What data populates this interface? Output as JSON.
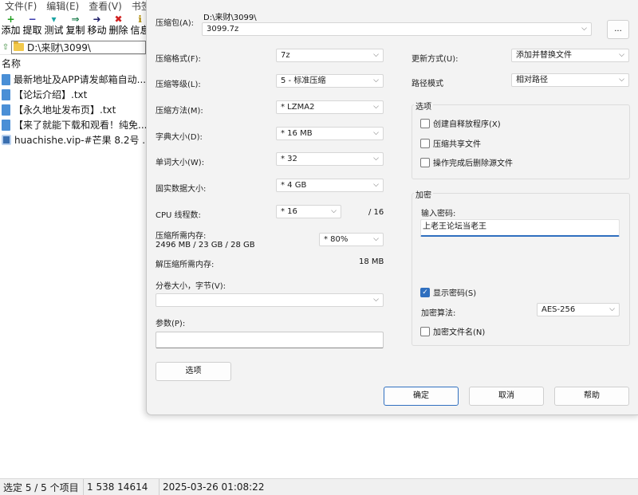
{
  "file_manager": {
    "menu": [
      "文件(F)",
      "编辑(E)",
      "查看(V)",
      "书签"
    ],
    "toolbar": [
      {
        "label": "添加",
        "icon": "+",
        "key": "ai"
      },
      {
        "label": "提取",
        "icon": "−",
        "key": "ex"
      },
      {
        "label": "测试",
        "icon": "▾",
        "key": "te"
      },
      {
        "label": "复制",
        "icon": "⇒",
        "key": "co"
      },
      {
        "label": "移动",
        "icon": "➜",
        "key": "mo"
      },
      {
        "label": "删除",
        "icon": "✖",
        "key": "de"
      },
      {
        "label": "信息",
        "icon": "ℹ",
        "key": "in"
      }
    ],
    "address": "D:\\来财\\3099\\",
    "column_name": "名称",
    "files": [
      {
        "name": "最新地址及APP请发邮箱自动...",
        "type": "txt"
      },
      {
        "name": "【论坛介绍】.txt",
        "type": "txt"
      },
      {
        "name": "【永久地址发布页】.txt",
        "type": "txt"
      },
      {
        "name": "【来了就能下载和观看！纯免...",
        "type": "txt"
      },
      {
        "name": "huachishe.vip-#芒果 8.2号 ...",
        "type": "archive"
      }
    ],
    "status": {
      "selection": "选定 5 / 5 个项目",
      "size": "1 538 14614",
      "date": "2025-03-26 01:08:22"
    }
  },
  "dialog": {
    "archive_label": "压缩包(A):",
    "archive_path": "D:\\来财\\3099\\",
    "archive_name": "3099.7z",
    "browse": "...",
    "format": {
      "label": "压缩格式(F):",
      "value": "7z"
    },
    "level": {
      "label": "压缩等级(L):",
      "value": "5 - 标准压缩"
    },
    "method": {
      "label": "压缩方法(M):",
      "value": "*  LZMA2"
    },
    "dict": {
      "label": "字典大小(D):",
      "value": "*  16 MB"
    },
    "word": {
      "label": "单词大小(W):",
      "value": "*  32"
    },
    "solid": {
      "label": "固实数据大小:",
      "value": "*  4 GB"
    },
    "threads": {
      "label": "CPU 线程数:",
      "value": "*  16",
      "max": "/ 16"
    },
    "mem_compress": {
      "label": "压缩所需内存:",
      "detail": "2496 MB / 23 GB / 28 GB",
      "value": "* 80%"
    },
    "mem_decompress": {
      "label": "解压缩所需内存:",
      "value": "18 MB"
    },
    "volume": {
      "label": "分卷大小，字节(V):",
      "value": ""
    },
    "params": {
      "label": "参数(P):",
      "value": ""
    },
    "options_button": "选项",
    "update": {
      "label": "更新方式(U):",
      "value": "添加并替换文件"
    },
    "path_mode": {
      "label": "路径模式",
      "value": "相对路径"
    },
    "options_group": {
      "title": "选项",
      "sfx": "创建自释放程序(X)",
      "shared": "压缩共享文件",
      "delete": "操作完成后删除源文件"
    },
    "encrypt_group": {
      "title": "加密",
      "pwd_label": "输入密码:",
      "pwd_value": "上老王论坛当老王",
      "show_pwd": "显示密码(S)",
      "method_label": "加密算法:",
      "method_value": "AES-256",
      "encrypt_names": "加密文件名(N)"
    },
    "ok": "确定",
    "cancel": "取消",
    "help": "帮助"
  }
}
